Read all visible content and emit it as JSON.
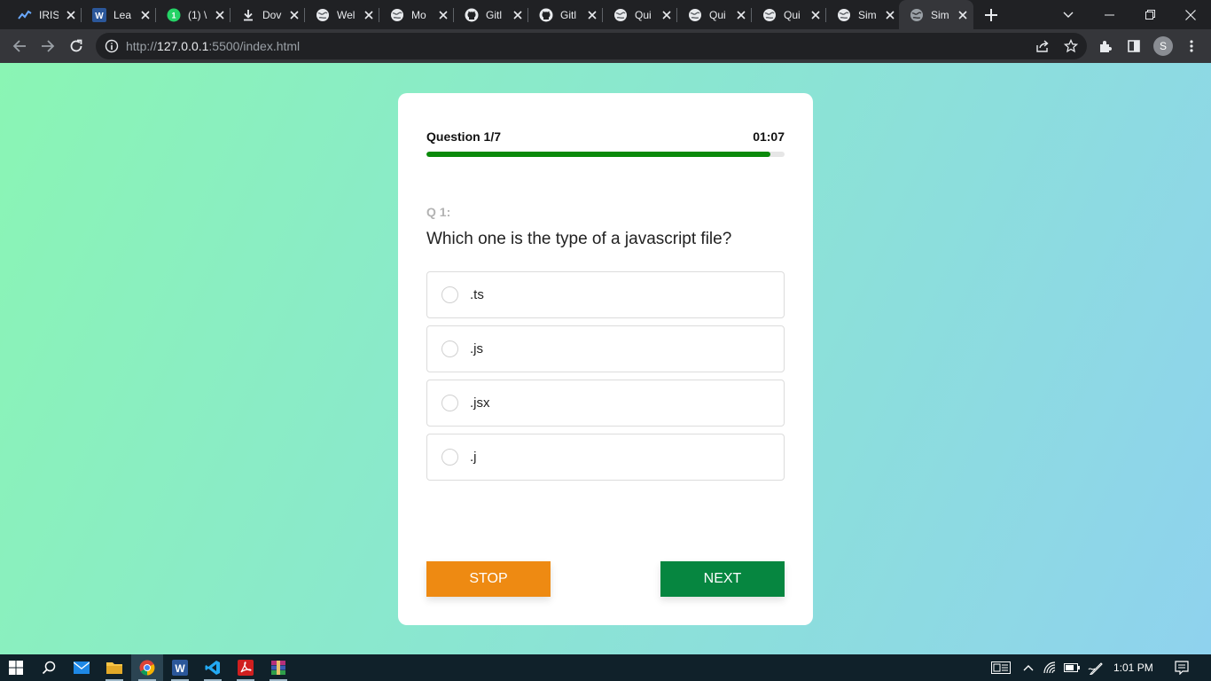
{
  "browser": {
    "tabs": [
      {
        "title": "IRIS",
        "icon": "chart-favicon-icon"
      },
      {
        "title": "Lea",
        "icon": "word-favicon-icon"
      },
      {
        "title": "(1) \\",
        "icon": "whatsapp-favicon-icon"
      },
      {
        "title": "Dov",
        "icon": "download-favicon-icon"
      },
      {
        "title": "Wel",
        "icon": "globe-favicon-icon"
      },
      {
        "title": "Mo",
        "icon": "globe-favicon-icon"
      },
      {
        "title": "Gitl",
        "icon": "github-favicon-icon"
      },
      {
        "title": "Gitl",
        "icon": "github-favicon-icon"
      },
      {
        "title": "Qui",
        "icon": "globe-favicon-icon"
      },
      {
        "title": "Qui",
        "icon": "globe-favicon-icon"
      },
      {
        "title": "Qui",
        "icon": "globe-favicon-icon"
      },
      {
        "title": "Sim",
        "icon": "globe-favicon-icon"
      },
      {
        "title": "Sim",
        "icon": "globe-favicon-icon",
        "active": true
      }
    ],
    "url_prefix": "http://",
    "url_host": "127.0.0.1",
    "url_rest": ":5500/index.html",
    "profile_initial": "S"
  },
  "quiz": {
    "question_counter": "Question 1/7",
    "timer": "01:07",
    "progress_fraction": 0.96,
    "question_number": "Q 1:",
    "question_text": "Which one is the type of a javascript file?",
    "options": [
      ".ts",
      ".js",
      ".jsx",
      ".j"
    ],
    "stop_label": "STOP",
    "next_label": "NEXT"
  },
  "taskbar": {
    "clock": "1:01 PM"
  },
  "colors": {
    "accent_progress": "#0a8a0a",
    "stop_button": "#ee8a12",
    "next_button": "#068640"
  }
}
